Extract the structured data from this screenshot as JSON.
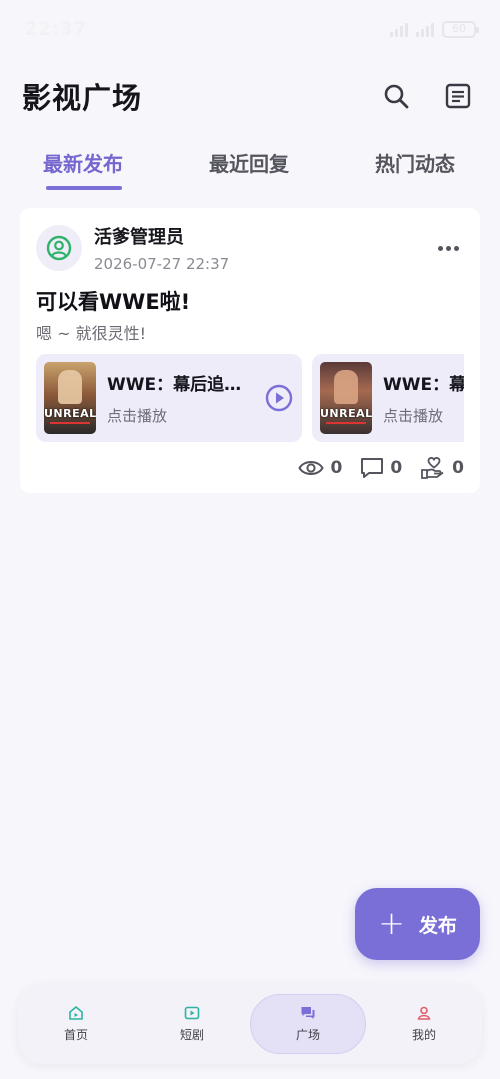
{
  "status_bar": {
    "time": "22:37",
    "battery": "60"
  },
  "header": {
    "title": "影视广场"
  },
  "tabs": [
    {
      "label": "最新发布",
      "active": true
    },
    {
      "label": "最近回复",
      "active": false
    },
    {
      "label": "热门动态",
      "active": false
    }
  ],
  "post": {
    "author": "活爹管理员",
    "time": "2026-07-27 22:37",
    "title": "可以看WWE啦!",
    "subtitle": "嗯 ~ 就很灵性!",
    "media": [
      {
        "title": "WWE：幕后追…",
        "action": "点击播放",
        "poster_text": "UNREAL"
      },
      {
        "title": "WWE：幕",
        "action": "点击播放",
        "poster_text": "UNREAL"
      }
    ],
    "stats": {
      "views": "0",
      "comments": "0",
      "likes": "0"
    }
  },
  "fab": {
    "label": "发布"
  },
  "bottom_nav": [
    {
      "label": "首页",
      "icon": "home-icon"
    },
    {
      "label": "短剧",
      "icon": "video-icon"
    },
    {
      "label": "广场",
      "icon": "chat-icon",
      "active": true
    },
    {
      "label": "我的",
      "icon": "user-icon"
    }
  ],
  "colors": {
    "accent": "#7a6fd6",
    "green": "#2fb36b",
    "nav_teal": "#2bb5a0",
    "nav_red": "#e05a6a"
  }
}
